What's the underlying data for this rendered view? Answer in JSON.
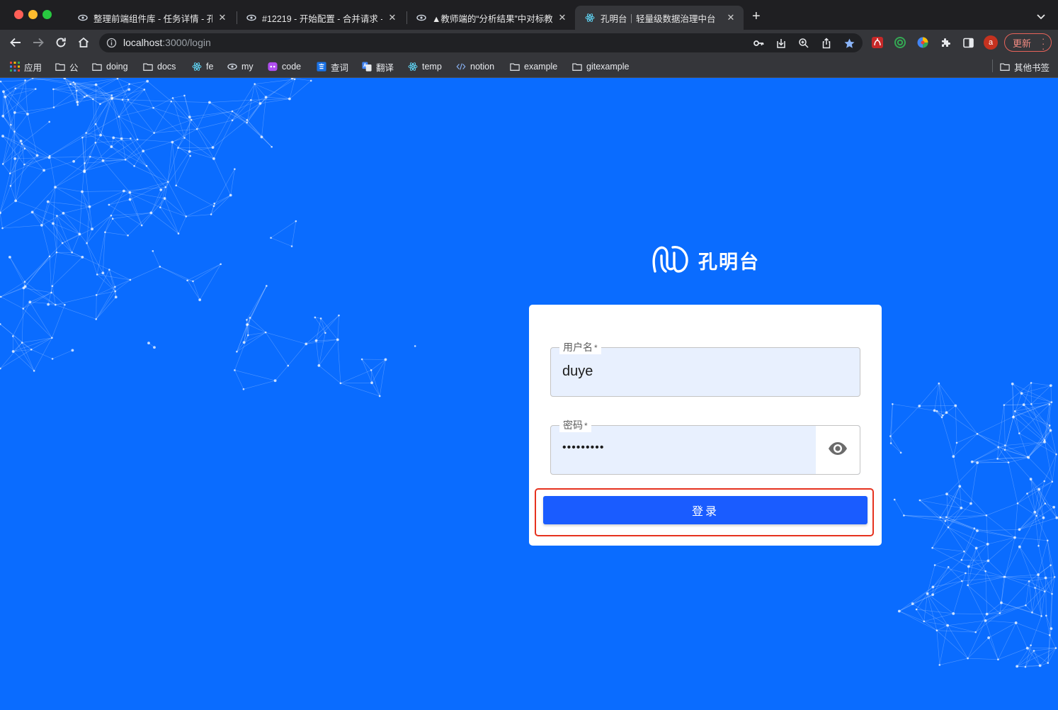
{
  "browser": {
    "tabs": [
      {
        "title": "整理前端组件库 - 任务详情 - 孔明台",
        "favicon": "eye-icon",
        "active": false
      },
      {
        "title": "#12219 - 开始配置 - 合并请求 - ",
        "favicon": "eye-icon",
        "active": false
      },
      {
        "title": "▲教师端的“分析结果”中对标教研",
        "favicon": "eye-icon",
        "active": false
      },
      {
        "title": "孔明台｜轻量级数据治理中台",
        "favicon": "react-icon",
        "active": true
      }
    ],
    "url_host": "localhost",
    "url_path": ":3000/login",
    "profile_initial": "a",
    "update_label": "更新",
    "bookmarks": [
      {
        "label": "应用",
        "icon": "apps-grid-icon"
      },
      {
        "label": "公",
        "icon": "folder-icon"
      },
      {
        "label": "doing",
        "icon": "folder-icon"
      },
      {
        "label": "docs",
        "icon": "folder-icon"
      },
      {
        "label": "fe",
        "icon": "react-icon"
      },
      {
        "label": "my",
        "icon": "eye-icon"
      },
      {
        "label": "code",
        "icon": "code-bot-icon"
      },
      {
        "label": "查词",
        "icon": "translate-icon"
      },
      {
        "label": "翻译",
        "icon": "google-translate-icon"
      },
      {
        "label": "temp",
        "icon": "react-icon"
      },
      {
        "label": "notion",
        "icon": "code-brackets-icon"
      },
      {
        "label": "example",
        "icon": "folder-icon"
      },
      {
        "label": "gitexample",
        "icon": "folder-icon"
      }
    ],
    "other_bookmarks": "其他书签"
  },
  "login": {
    "brand_name": "孔明台",
    "username_label": "用户名",
    "username_value": "duye",
    "password_label": "密码",
    "password_masked": "•••••••••",
    "required_mark": "*",
    "submit_label": "登录"
  },
  "colors": {
    "page_background": "#0a6cff",
    "button": "#1a5cff",
    "input_fill": "#e8f0fe",
    "highlight": "#e6321e"
  }
}
